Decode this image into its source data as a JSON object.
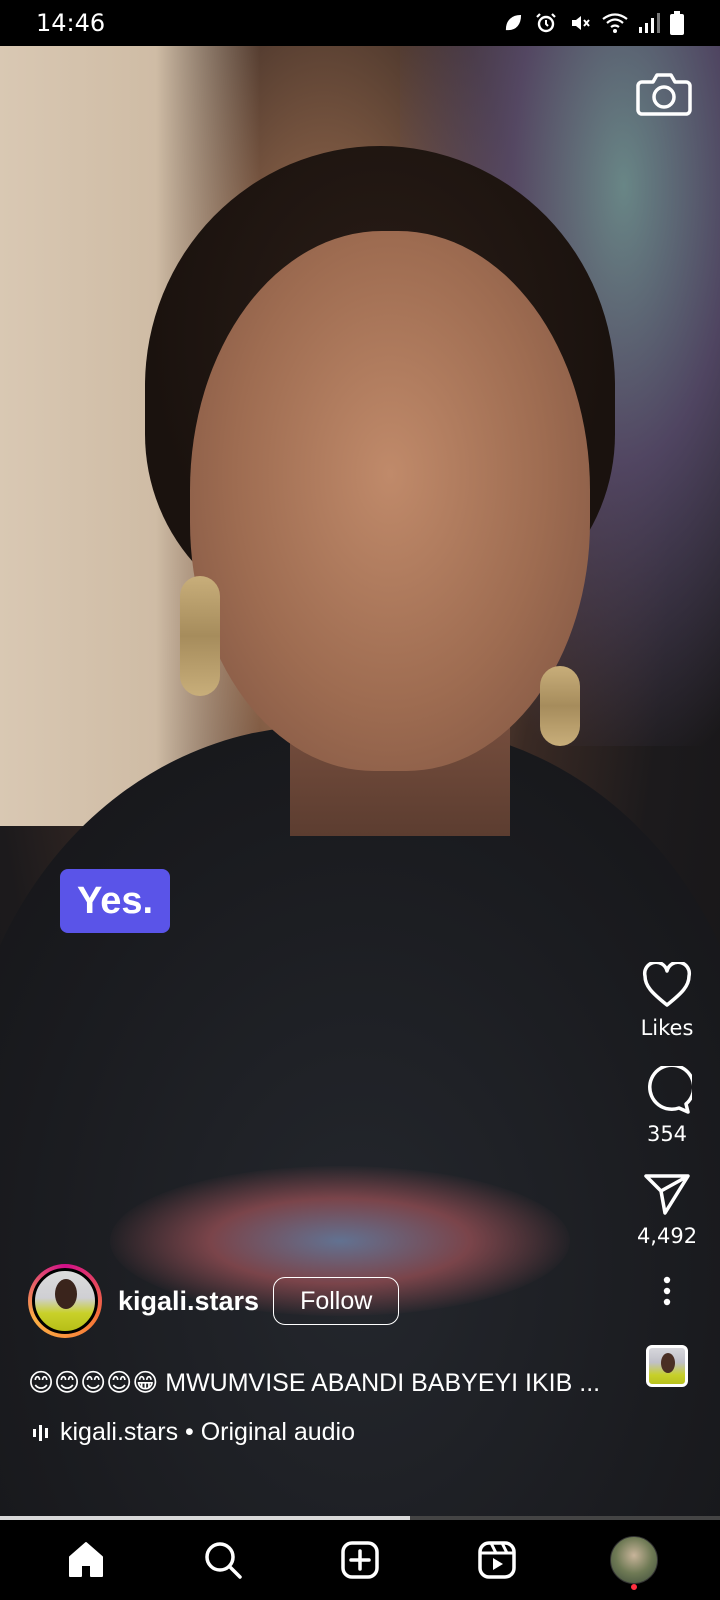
{
  "status_bar": {
    "time": "14:46",
    "icons": [
      "leaf-icon",
      "alarm-icon",
      "mute-icon",
      "wifi-icon",
      "signal-icon",
      "battery-icon"
    ]
  },
  "reel": {
    "caption_sticker": "Yes.",
    "progress_fraction": 0.57
  },
  "actions": {
    "likes_label": "Likes",
    "comments_count": "354",
    "shares_count": "4,492"
  },
  "author": {
    "username": "kigali.stars",
    "follow_label": "Follow"
  },
  "caption": "😊😊😊😊😁 MWUMVISE ABANDI BABYEYI IKIB ...",
  "audio": {
    "text": "kigali.stars • Original audio"
  },
  "bottom_nav": {
    "items": [
      "home-icon",
      "search-icon",
      "create-icon",
      "reels-icon",
      "profile-avatar"
    ]
  },
  "colors": {
    "sticker": "#5a54e8",
    "avatar_ring": "#d10f8a",
    "notification_dot": "#ff3040"
  }
}
